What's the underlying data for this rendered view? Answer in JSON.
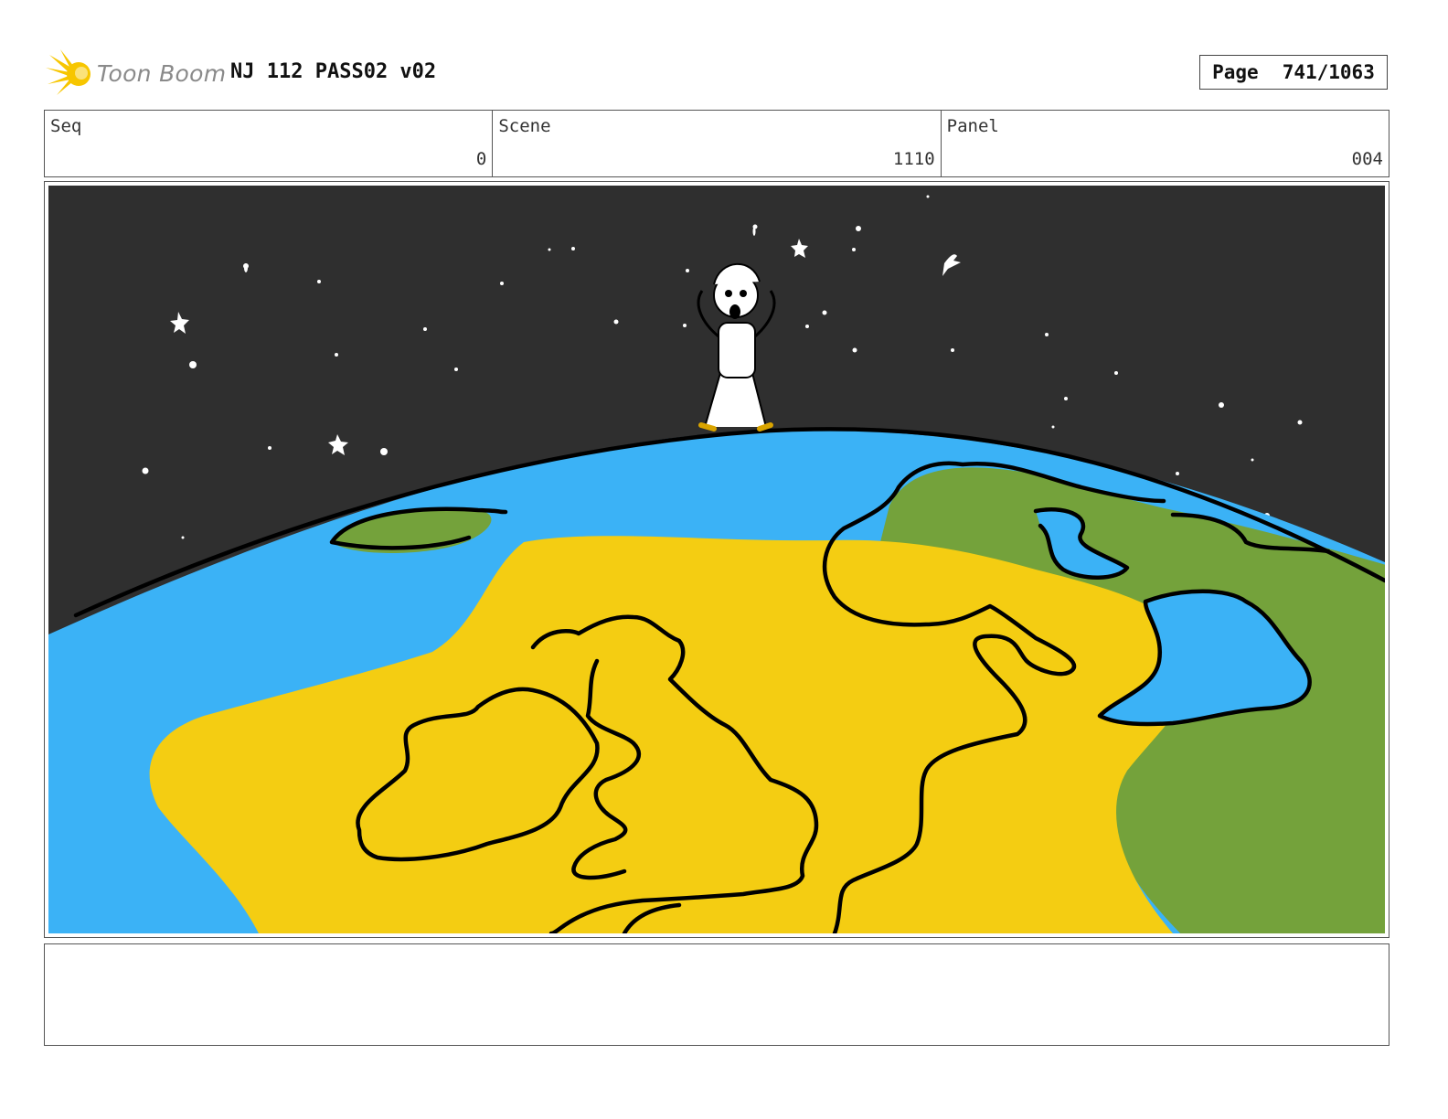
{
  "header": {
    "logo_text": "Toon Boom",
    "title": "NJ 112 PASS02 v02",
    "page_label": "Page",
    "page_value": "741/1063"
  },
  "info": {
    "seq_label": "Seq",
    "seq_value": "0",
    "scene_label": "Scene",
    "scene_value": "1110",
    "panel_label": "Panel",
    "panel_value": "004"
  },
  "colors": {
    "space": "#2f2f2f",
    "ocean": "#3bb2f6",
    "land_yellow": "#f4cd12",
    "land_green": "#74a23b",
    "logo_accent": "#f7c600"
  },
  "notes": {
    "text": ""
  }
}
